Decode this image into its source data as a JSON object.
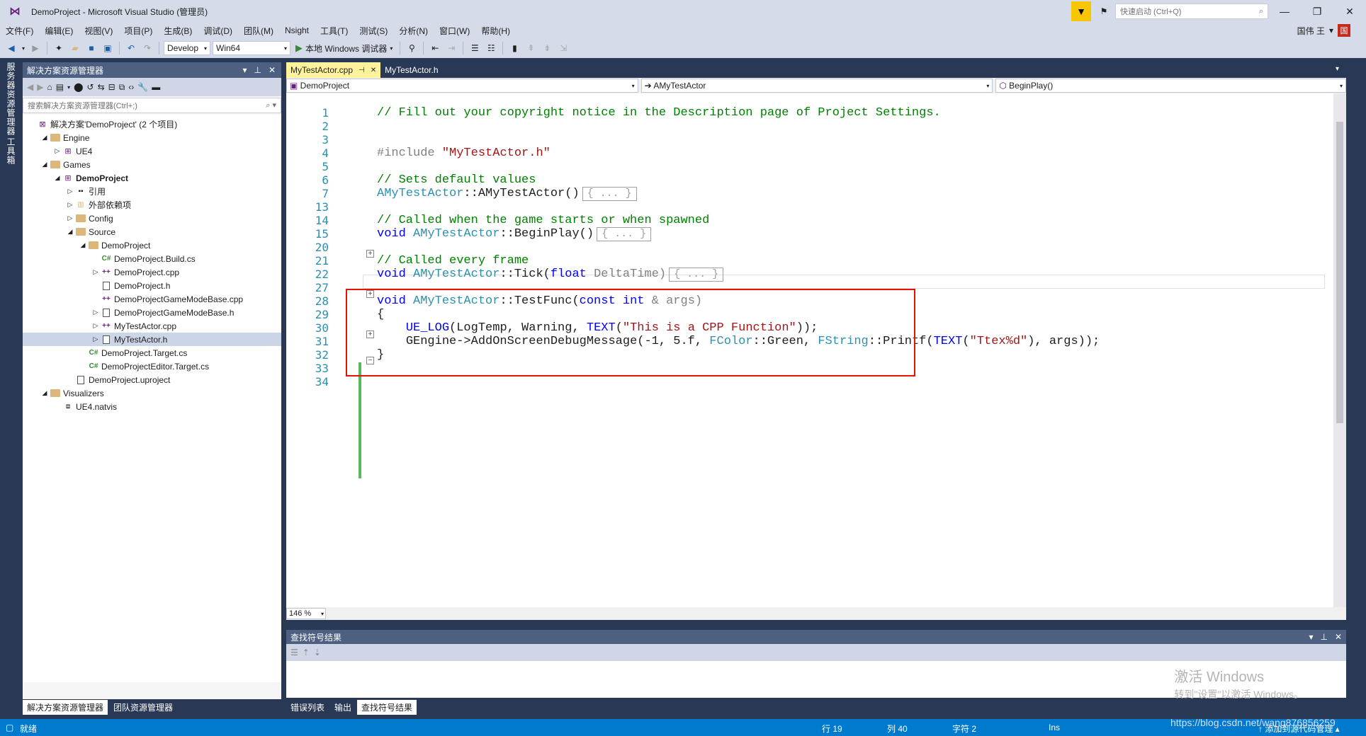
{
  "window": {
    "title": "DemoProject - Microsoft Visual Studio (管理员)",
    "quick_launch_placeholder": "快速启动 (Ctrl+Q)",
    "user_name": "国伟 王",
    "user_badge": "国"
  },
  "menu": [
    "文件(F)",
    "编辑(E)",
    "视图(V)",
    "项目(P)",
    "生成(B)",
    "调试(D)",
    "团队(M)",
    "Nsight",
    "工具(T)",
    "测试(S)",
    "分析(N)",
    "窗口(W)",
    "帮助(H)"
  ],
  "toolbar": {
    "config": "Develop",
    "platform": "Win64",
    "run_label": "本地 Windows 调试器"
  },
  "left_strip": {
    "server_explorer": "服务器资源管理器",
    "toolbox": "工具箱"
  },
  "solution_explorer": {
    "title": "解决方案资源管理器",
    "search_placeholder": "搜索解决方案资源管理器(Ctrl+;)",
    "tree": [
      {
        "label": "解决方案'DemoProject' (2 个项目)",
        "indent": 0,
        "arrow": "",
        "icon": "sln",
        "bold": false
      },
      {
        "label": "Engine",
        "indent": 1,
        "arrow": "◢",
        "icon": "folder",
        "bold": false
      },
      {
        "label": "UE4",
        "indent": 2,
        "arrow": "▷",
        "icon": "proj",
        "bold": false
      },
      {
        "label": "Games",
        "indent": 1,
        "arrow": "◢",
        "icon": "folder",
        "bold": false
      },
      {
        "label": "DemoProject",
        "indent": 2,
        "arrow": "◢",
        "icon": "proj",
        "bold": true
      },
      {
        "label": "引用",
        "indent": 3,
        "arrow": "▷",
        "icon": "ref",
        "bold": false
      },
      {
        "label": "外部依赖项",
        "indent": 3,
        "arrow": "▷",
        "icon": "ext",
        "bold": false
      },
      {
        "label": "Config",
        "indent": 3,
        "arrow": "▷",
        "icon": "folder",
        "bold": false
      },
      {
        "label": "Source",
        "indent": 3,
        "arrow": "◢",
        "icon": "folder",
        "bold": false
      },
      {
        "label": "DemoProject",
        "indent": 4,
        "arrow": "◢",
        "icon": "folder",
        "bold": false
      },
      {
        "label": "DemoProject.Build.cs",
        "indent": 5,
        "arrow": "",
        "icon": "cs",
        "bold": false
      },
      {
        "label": "DemoProject.cpp",
        "indent": 5,
        "arrow": "▷",
        "icon": "cpp",
        "bold": false
      },
      {
        "label": "DemoProject.h",
        "indent": 5,
        "arrow": "",
        "icon": "h",
        "bold": false
      },
      {
        "label": "DemoProjectGameModeBase.cpp",
        "indent": 5,
        "arrow": "",
        "icon": "cpp",
        "bold": false
      },
      {
        "label": "DemoProjectGameModeBase.h",
        "indent": 5,
        "arrow": "▷",
        "icon": "h",
        "bold": false
      },
      {
        "label": "MyTestActor.cpp",
        "indent": 5,
        "arrow": "▷",
        "icon": "cpp",
        "bold": false
      },
      {
        "label": "MyTestActor.h",
        "indent": 5,
        "arrow": "▷",
        "icon": "h",
        "bold": false,
        "selected": true
      },
      {
        "label": "DemoProject.Target.cs",
        "indent": 4,
        "arrow": "",
        "icon": "cs",
        "bold": false
      },
      {
        "label": "DemoProjectEditor.Target.cs",
        "indent": 4,
        "arrow": "",
        "icon": "cs",
        "bold": false
      },
      {
        "label": "DemoProject.uproject",
        "indent": 3,
        "arrow": "",
        "icon": "file",
        "bold": false
      },
      {
        "label": "Visualizers",
        "indent": 1,
        "arrow": "◢",
        "icon": "folder",
        "bold": false
      },
      {
        "label": "UE4.natvis",
        "indent": 2,
        "arrow": "",
        "icon": "natvis",
        "bold": false
      }
    ],
    "bottom_tabs": [
      "解决方案资源管理器",
      "团队资源管理器"
    ]
  },
  "editor": {
    "tabs": [
      {
        "label": "MyTestActor.cpp",
        "active": true
      },
      {
        "label": "MyTestActor.h",
        "active": false
      }
    ],
    "nav_project": "DemoProject",
    "nav_class": "AMyTestActor",
    "nav_member": "BeginPlay()",
    "line_numbers": [
      "1",
      "2",
      "3",
      "4",
      "5",
      "6",
      "7",
      "13",
      "14",
      "15",
      "20",
      "21",
      "22",
      "27",
      "28",
      "29",
      "30",
      "31",
      "32",
      "33",
      "34"
    ],
    "code": {
      "l1": "// Fill out your copyright notice in the Description page of Project Settings.",
      "l4_pp": "#include ",
      "l4_str": "\"MyTestActor.h\"",
      "l6": "// Sets default values",
      "l7_class": "AMyTestActor",
      "l7_rest": "::AMyTestActor()",
      "l14": "// Called when the game starts or when spawned",
      "l15_kw": "void ",
      "l15_class": "AMyTestActor",
      "l15_rest": "::BeginPlay()",
      "l21": "// Called every frame",
      "l22_kw": "void ",
      "l22_class": "AMyTestActor",
      "l22_rest": "::Tick(",
      "l22_kw2": "float",
      "l22_param": " DeltaTime)",
      "l28_kw": "void ",
      "l28_class": "AMyTestActor",
      "l28_rest": "::TestFunc(",
      "l28_kw2": "const int",
      "l28_param": " & args)",
      "l29": "{",
      "l30_macro": "UE_LOG",
      "l30_a": "(LogTemp, Warning, ",
      "l30_macro2": "TEXT",
      "l30_b": "(",
      "l30_str": "\"This is a CPP Function\"",
      "l30_c": "));",
      "l31_a": "GEngine->AddOnScreenDebugMessage(-1, 5.f, ",
      "l31_ty1": "FColor",
      "l31_b": "::Green, ",
      "l31_ty2": "FString",
      "l31_c": "::Printf(",
      "l31_macro": "TEXT",
      "l31_d": "(",
      "l31_str": "\"Ttex%d\"",
      "l31_e": "), args));",
      "l32": "}",
      "collapsed": "{ ... }"
    },
    "zoom": "146 %"
  },
  "find_panel": {
    "title": "查找符号结果",
    "bottom_tabs": [
      "错误列表",
      "输出",
      "查找符号结果"
    ],
    "watermark_line1": "激活 Windows",
    "watermark_line2": "转到\"设置\"以激活 Windows。"
  },
  "status": {
    "ready": "就绪",
    "line": "行 19",
    "col": "列 40",
    "char": "字符 2",
    "ins": "Ins",
    "add_source": "↑ 添加到源代码管理 ▴",
    "url_overlay": "https://blog.csdn.net/wang876856259"
  }
}
